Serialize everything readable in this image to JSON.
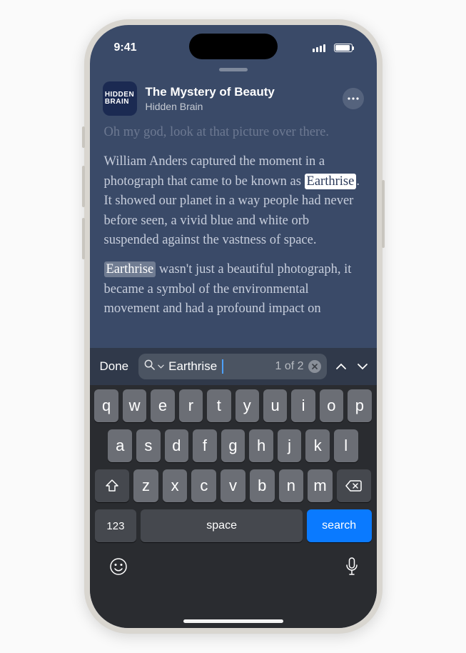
{
  "status": {
    "time": "9:41"
  },
  "episode": {
    "title": "The Mystery of Beauty",
    "show": "Hidden Brain",
    "artwork_text": "HIDDEN BRAIN"
  },
  "transcript": {
    "faded_prev": "Oh my god, look at that picture over there.",
    "para1_a": "William Anders captured the moment in a photograph that came to be known as ",
    "para1_hl": "Earthrise",
    "para1_b": ". It showed our planet in a way people had never before seen, a vivid blue and white orb suspended against the vastness of space.",
    "para2_hl": "Earthrise",
    "para2_a": " wasn't just a beautiful photograph, it became a symbol of the environmental movement and had a profound impact on"
  },
  "search": {
    "done_label": "Done",
    "term": "Earthrise",
    "result_count": "1 of 2"
  },
  "keyboard": {
    "row1": [
      "q",
      "w",
      "e",
      "r",
      "t",
      "y",
      "u",
      "i",
      "o",
      "p"
    ],
    "row2": [
      "a",
      "s",
      "d",
      "f",
      "g",
      "h",
      "j",
      "k",
      "l"
    ],
    "row3": [
      "z",
      "x",
      "c",
      "v",
      "b",
      "n",
      "m"
    ],
    "numbers_label": "123",
    "space_label": "space",
    "action_label": "search"
  }
}
